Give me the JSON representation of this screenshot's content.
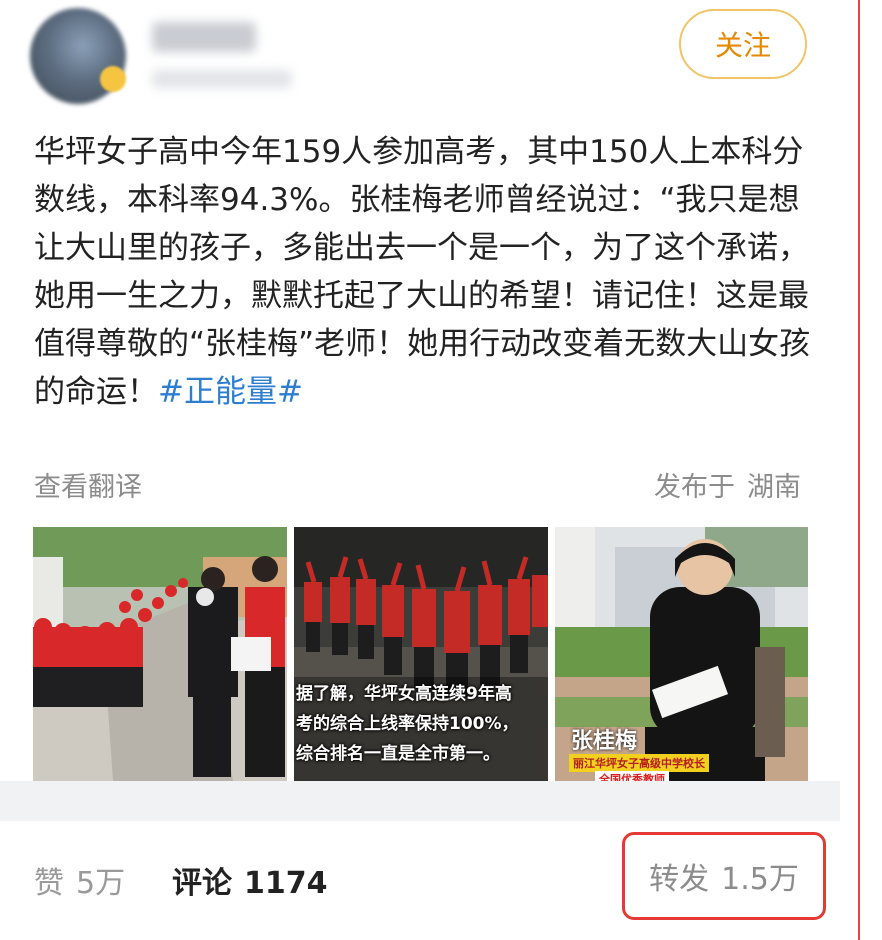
{
  "header": {
    "follow_label": "关注"
  },
  "post": {
    "text": "华坪女子高中今年159人参加高考，其中150人上本科分数线，本科率94.3%。张桂梅老师曾经说过：“我只是想让大山里的孩子，多能出去一个是一个，为了这个承诺，她用一生之力，默默托起了大山的希望！请记住！这是最值得尊敬的“张桂梅”老师！她用行动改变着无数大山女孩的命运！",
    "hashtag": "#正能量#",
    "translate_label": "查看翻译",
    "location_prefix": "发布于",
    "location": "湖南"
  },
  "photos": {
    "photo2_caption_lines": [
      "据了解，华坪女高连续9年高",
      "考的综合上线率保持100%，",
      "综合排名一直是全市第一。"
    ],
    "photo3_name": "张桂梅",
    "photo3_school": "丽江华坪女子高级中学校长",
    "photo3_honor": "全国优秀教师"
  },
  "actions": {
    "like_label": "赞",
    "like_count": "5万",
    "comment_label": "评论",
    "comment_count": "1174",
    "repost_label": "转发",
    "repost_count": "1.5万"
  },
  "colors": {
    "accent_orange": "#e38a00",
    "hashtag_blue": "#2e7ecf",
    "highlight_red": "#e53935"
  }
}
